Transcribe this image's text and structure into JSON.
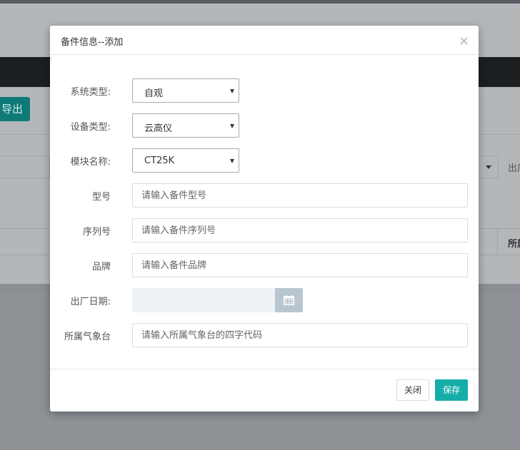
{
  "background": {
    "export_label": "导出",
    "filter_label": "出厂",
    "table_header_label": "所属"
  },
  "modal": {
    "title": "备件信息--添加",
    "close_symbol": "×",
    "fields": {
      "system_type": {
        "label": "系统类型:",
        "value": "自观"
      },
      "device_type": {
        "label": "设备类型:",
        "value": "云高仪"
      },
      "module_name": {
        "label": "模块名称:",
        "value": "CT25K"
      },
      "model": {
        "label": "型号",
        "placeholder": "请输入备件型号"
      },
      "serial": {
        "label": "序列号",
        "placeholder": "请输入备件序列号"
      },
      "brand": {
        "label": "品牌",
        "placeholder": "请输入备件品牌"
      },
      "factory_date": {
        "label": "出厂日期:",
        "value": ""
      },
      "station": {
        "label": "所属气象台",
        "placeholder": "请输入所属气象台的四字代码"
      }
    },
    "buttons": {
      "close_label": "关闭",
      "save_label": "保存"
    }
  },
  "colors": {
    "accent": "#17aeaa",
    "overlay": "#b4b7ba",
    "date_button": "#b9c6cf"
  }
}
